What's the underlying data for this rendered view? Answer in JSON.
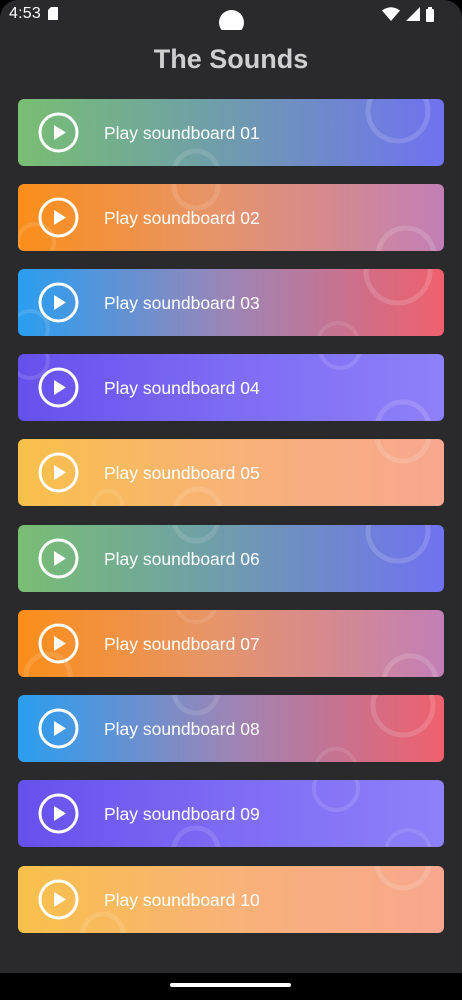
{
  "status_bar": {
    "time": "4:53",
    "icons": [
      "sd-card-icon",
      "wifi-icon",
      "signal-icon",
      "battery-icon"
    ]
  },
  "app_bar": {
    "title": "The Sounds"
  },
  "theme": {
    "background": "#2a292b",
    "title_color": "#cfcfcf",
    "text_color": "#ffffff"
  },
  "soundboards": [
    {
      "label": "Play soundboard 01",
      "icon": "play-circle-icon",
      "gradient": "green-to-blue"
    },
    {
      "label": "Play soundboard 02",
      "icon": "play-circle-icon",
      "gradient": "orange-to-pink"
    },
    {
      "label": "Play soundboard 03",
      "icon": "play-circle-icon",
      "gradient": "blue-to-red"
    },
    {
      "label": "Play soundboard 04",
      "icon": "play-circle-icon",
      "gradient": "purple"
    },
    {
      "label": "Play soundboard 05",
      "icon": "play-circle-icon",
      "gradient": "yellow-to-peach"
    },
    {
      "label": "Play soundboard 06",
      "icon": "play-circle-icon",
      "gradient": "green-to-blue"
    },
    {
      "label": "Play soundboard 07",
      "icon": "play-circle-icon",
      "gradient": "orange-to-pink"
    },
    {
      "label": "Play soundboard 08",
      "icon": "play-circle-icon",
      "gradient": "blue-to-red"
    },
    {
      "label": "Play soundboard 09",
      "icon": "play-circle-icon",
      "gradient": "purple"
    },
    {
      "label": "Play soundboard 10",
      "icon": "play-circle-icon",
      "gradient": "yellow-to-peach"
    }
  ]
}
